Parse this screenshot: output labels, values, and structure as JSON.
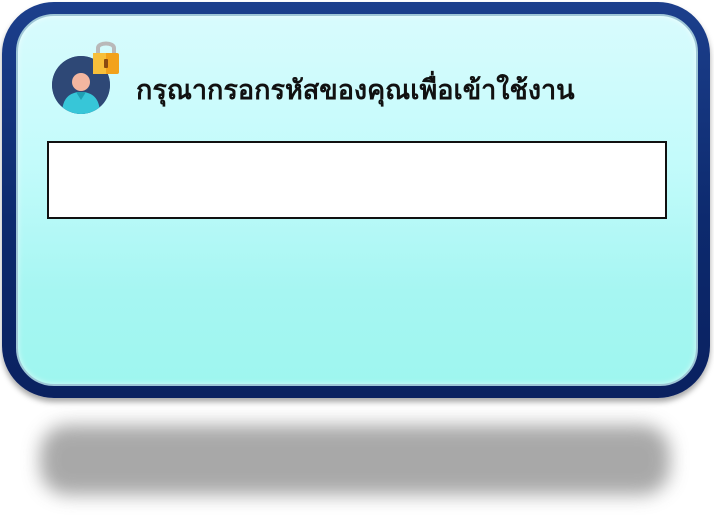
{
  "dialog": {
    "title": "กรุณากรอกรหัสของคุณเพื่อเข้าใช้งาน",
    "code_input": {
      "value": "",
      "placeholder": ""
    },
    "icons": {
      "user": "user-avatar-icon",
      "lock": "padlock-icon"
    }
  },
  "colors": {
    "frame": "#0d2a6e",
    "panel_top": "#d8fbfd",
    "panel_bottom": "#9ef6ef",
    "lock_body": "#f2a21b",
    "avatar_bg": "#2e4876"
  }
}
